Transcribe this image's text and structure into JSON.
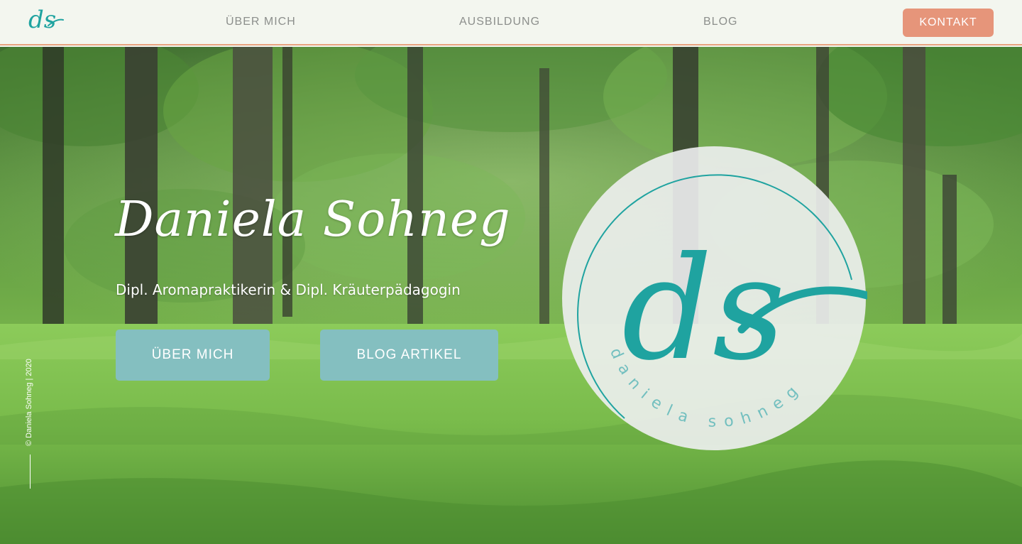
{
  "header": {
    "logo_text": "ds",
    "nav": {
      "ueber_mich": "ÜBER MICH",
      "ausbildung": "AUSBILDUNG",
      "blog": "BLOG"
    },
    "kontakt": "KONTAKT"
  },
  "hero": {
    "title": "Daniela Sohneg",
    "subtitle": "Dipl. Aromapraktikerin & Dipl. Kräuterpädagogin",
    "buttons": {
      "ueber_mich": "ÜBER MICH",
      "blog_artikel": "BLOG ARTIKEL"
    },
    "copyright": "© Daniela Sohneg | 2020"
  },
  "logo": {
    "monogram": "ds",
    "ring_text": "daniela sohneg"
  },
  "colors": {
    "header_bg": "#f3f6ef",
    "accent_orange": "#e6957a",
    "button_teal": "#84bfc0",
    "logo_teal": "#1fa3a0",
    "nav_text": "#8c8f8c"
  }
}
